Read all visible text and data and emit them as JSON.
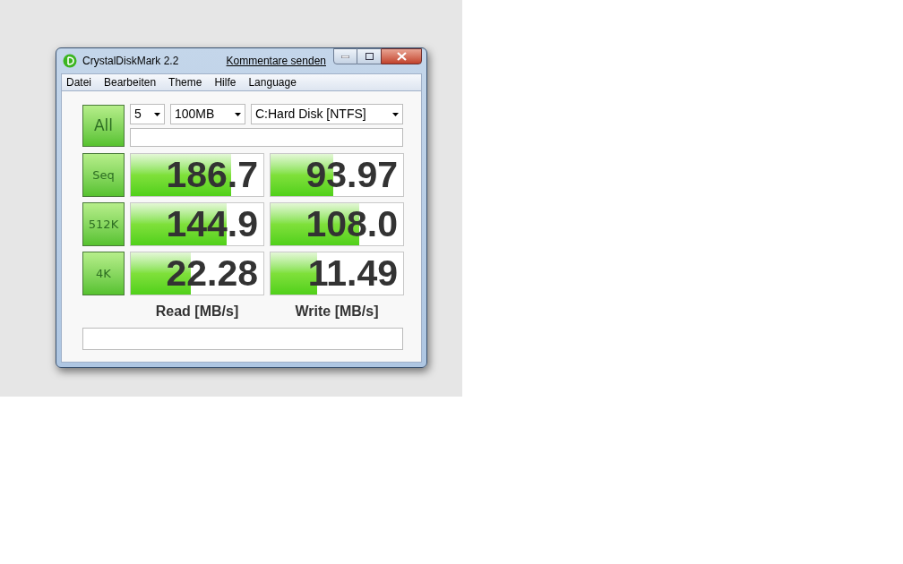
{
  "window": {
    "title": "CrystalDiskMark 2.2",
    "link": "Kommentare senden"
  },
  "menu": [
    "Datei",
    "Bearbeiten",
    "Theme",
    "Hilfe",
    "Language"
  ],
  "all_button": "All",
  "settings": {
    "count": "5",
    "size": "100MB",
    "drive": "C:Hard Disk [NTFS]"
  },
  "tests": [
    {
      "label": "Seq",
      "read": {
        "value": "186.7",
        "level": 0.76
      },
      "write": {
        "value": "93.97",
        "level": 0.47
      }
    },
    {
      "label": "512K",
      "read": {
        "value": "144.9",
        "level": 0.72
      },
      "write": {
        "value": "108.0",
        "level": 0.67
      }
    },
    {
      "label": "4K",
      "read": {
        "value": "22.28",
        "level": 0.45
      },
      "write": {
        "value": "11.49",
        "level": 0.35
      }
    }
  ],
  "columns": [
    "Read [MB/s]",
    "Write [MB/s]"
  ]
}
